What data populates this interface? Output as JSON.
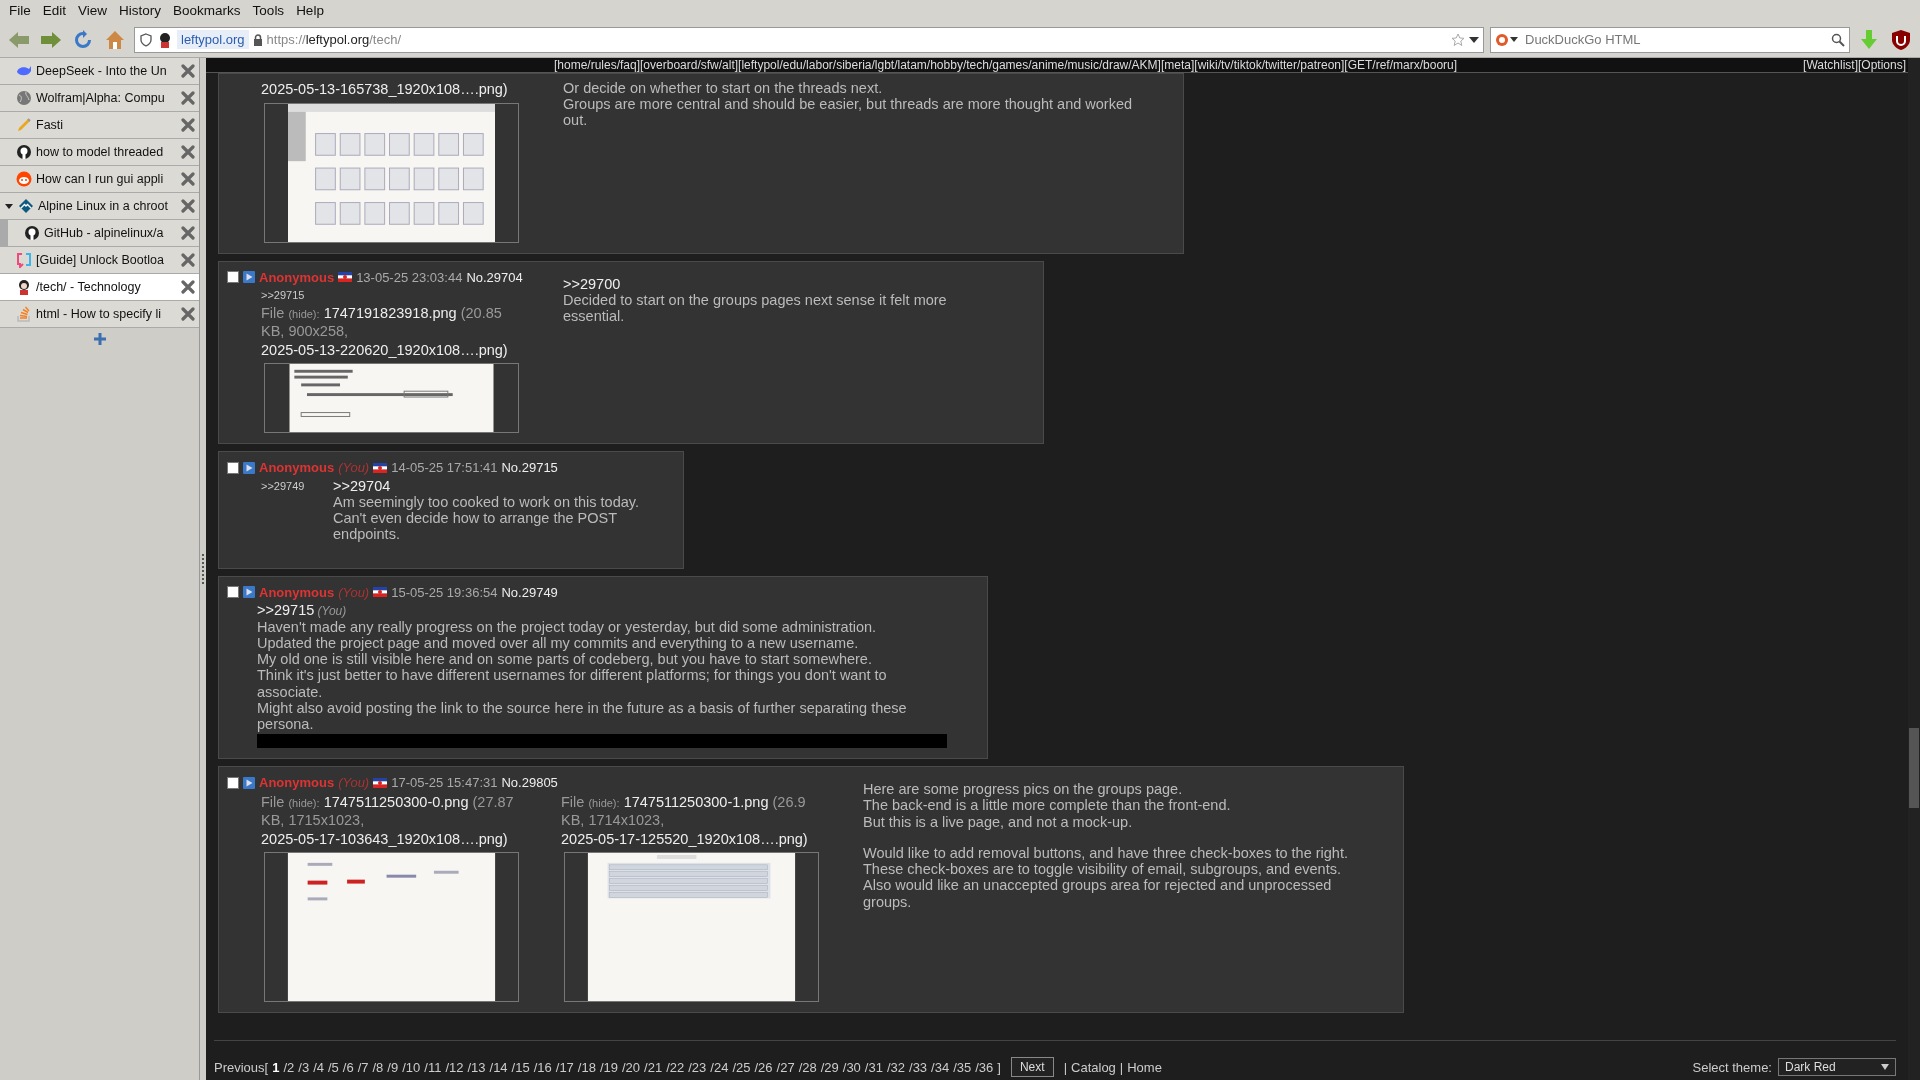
{
  "menu": [
    "File",
    "Edit",
    "View",
    "History",
    "Bookmarks",
    "Tools",
    "Help"
  ],
  "toolbar": {
    "site_label": "leftypol.org",
    "url_scheme": "https://",
    "url_host": "leftypol.org",
    "url_path": "/tech/",
    "search_placeholder": "DuckDuckGo HTML"
  },
  "tabs": [
    {
      "title": "DeepSeek - Into the Un",
      "selected": false
    },
    {
      "title": "Wolfram|Alpha: Compu",
      "selected": false
    },
    {
      "title": "Fasti",
      "selected": false
    },
    {
      "title": "how to model threaded",
      "selected": false
    },
    {
      "title": "How can I run gui appli",
      "selected": false
    },
    {
      "title": "Alpine Linux in a chroot",
      "selected": false,
      "expanded": true,
      "children": [
        {
          "title": "GitHub - alpinelinux/a",
          "selected": false
        }
      ]
    },
    {
      "title": "[Guide] Unlock Bootloa",
      "selected": false
    },
    {
      "title": "/tech/ - Technology",
      "selected": true
    },
    {
      "title": "html - How to specify li",
      "selected": false
    }
  ],
  "board_nav": {
    "groups": [
      "[home/rules/faq]",
      "[overboard/sfw/alt]",
      "[leftypol/edu/labor/siberia/lgbt/latam/hobby/tech/games/anime/music/draw/AKM]",
      "[meta]",
      "[wiki/tv/tiktok/twitter/patreon]",
      "[GET/ref/marx/booru]"
    ],
    "right": [
      "[Watchlist]",
      "[Options]"
    ]
  },
  "posts": [
    {
      "files": [
        {
          "original_name": "2025-05-13-165738_1920x108….png)"
        }
      ],
      "body": [
        [
          "Or decide on whether to start on the threads next.",
          "Groups are more central and should be easier, but threads are more thought and worked out."
        ]
      ]
    },
    {
      "checked": false,
      "name": "Anonymous",
      "date": "13-05-25 23:03:44",
      "number": "No.29704",
      "backlinks": [
        ">>29715"
      ],
      "files": [
        {
          "label": "File",
          "hide": "(hide):",
          "filename": "1747191823918.png",
          "details": "(20.85 KB, 900x258,",
          "original_name": "2025-05-13-220620_1920x108….png)"
        }
      ],
      "quote": ">>29700",
      "body": [
        [
          "Decided to start on the groups pages next sense it felt more essential."
        ]
      ]
    },
    {
      "checked": false,
      "name": "Anonymous",
      "you": "(You)",
      "date": "14-05-25 17:51:41",
      "number": "No.29715",
      "backlinks": [
        ">>29749"
      ],
      "quote": ">>29704",
      "body": [
        [
          "Am seemingly too cooked to work on this today.",
          "Can't even decide how to arrange the POST endpoints."
        ]
      ]
    },
    {
      "checked": false,
      "name": "Anonymous",
      "you": "(You)",
      "date": "15-05-25 19:36:54",
      "number": "No.29749",
      "quote": ">>29715",
      "quote_you": "(You)",
      "spoiler": true,
      "body": [
        [
          "Haven't made any really progress on the project today or yesterday, but did some administration.",
          "Updated the project page and moved over all my commits and everything to a new username.",
          "My old one is still visible here and on some parts of codeberg, but you have to start somewhere.",
          "Think it's just better to have different usernames for different platforms; for things you don't want to associate.",
          "Might also avoid posting the link to the source here in the future as a basis of further separating these persona."
        ]
      ]
    },
    {
      "checked": false,
      "name": "Anonymous",
      "you": "(You)",
      "date": "17-05-25 15:47:31",
      "number": "No.29805",
      "files": [
        {
          "label": "File",
          "hide": "(hide):",
          "filename": "1747511250300-0.png",
          "details": "(27.87 KB, 1715x1023,",
          "original_name": "2025-05-17-103643_1920x108….png)"
        },
        {
          "label": "File",
          "hide": "(hide):",
          "filename": "1747511250300-1.png",
          "details": "(26.9 KB, 1714x1023,",
          "original_name": "2025-05-17-125520_1920x108….png)"
        }
      ],
      "body": [
        [
          "Here are some progress pics on the groups page.",
          "The back-end is a little more complete than the front-end.",
          "But this is a live page, and not a mock-up."
        ],
        [
          "Would like to add removal buttons, and have three check-boxes to the right.",
          "These check-boxes are to toggle visibility of email, subgroups, and events.",
          "Also would like an unaccepted groups area for rejected and unprocessed groups."
        ]
      ]
    }
  ],
  "pagination": {
    "previous": "Previous[",
    "pages": [
      {
        "label": "1",
        "selected": true
      },
      {
        "label": "/2",
        "selected": false
      },
      {
        "label": "/3",
        "selected": false
      },
      {
        "label": "/4",
        "selected": false
      },
      {
        "label": "/5",
        "selected": false
      },
      {
        "label": "/6",
        "selected": false
      },
      {
        "label": "/7",
        "selected": false
      },
      {
        "label": "/8",
        "selected": false
      },
      {
        "label": "/9",
        "selected": false
      },
      {
        "label": "/10",
        "selected": false
      },
      {
        "label": "/11",
        "selected": false
      },
      {
        "label": "/12",
        "selected": false
      },
      {
        "label": "/13",
        "selected": false
      },
      {
        "label": "/14",
        "selected": false
      },
      {
        "label": "/15",
        "selected": false
      },
      {
        "label": "/16",
        "selected": false
      },
      {
        "label": "/17",
        "selected": false
      },
      {
        "label": "/18",
        "selected": false
      },
      {
        "label": "/19",
        "selected": false
      },
      {
        "label": "/20",
        "selected": false
      },
      {
        "label": "/21",
        "selected": false
      },
      {
        "label": "/22",
        "selected": false
      },
      {
        "label": "/23",
        "selected": false
      },
      {
        "label": "/24",
        "selected": false
      },
      {
        "label": "/25",
        "selected": false
      },
      {
        "label": "/26",
        "selected": false
      },
      {
        "label": "/27",
        "selected": false
      },
      {
        "label": "/28",
        "selected": false
      },
      {
        "label": "/29",
        "selected": false
      },
      {
        "label": "/30",
        "selected": false
      },
      {
        "label": "/31",
        "selected": false
      },
      {
        "label": "/32",
        "selected": false
      },
      {
        "label": "/33",
        "selected": false
      },
      {
        "label": "/34",
        "selected": false
      },
      {
        "label": "/35",
        "selected": false
      },
      {
        "label": "/36",
        "selected": false
      }
    ],
    "close": "]",
    "next": "Next",
    "separator": "|",
    "links": [
      "Catalog",
      "Home"
    ]
  },
  "theme": {
    "label": "Select theme:",
    "value": "Dark Red"
  }
}
